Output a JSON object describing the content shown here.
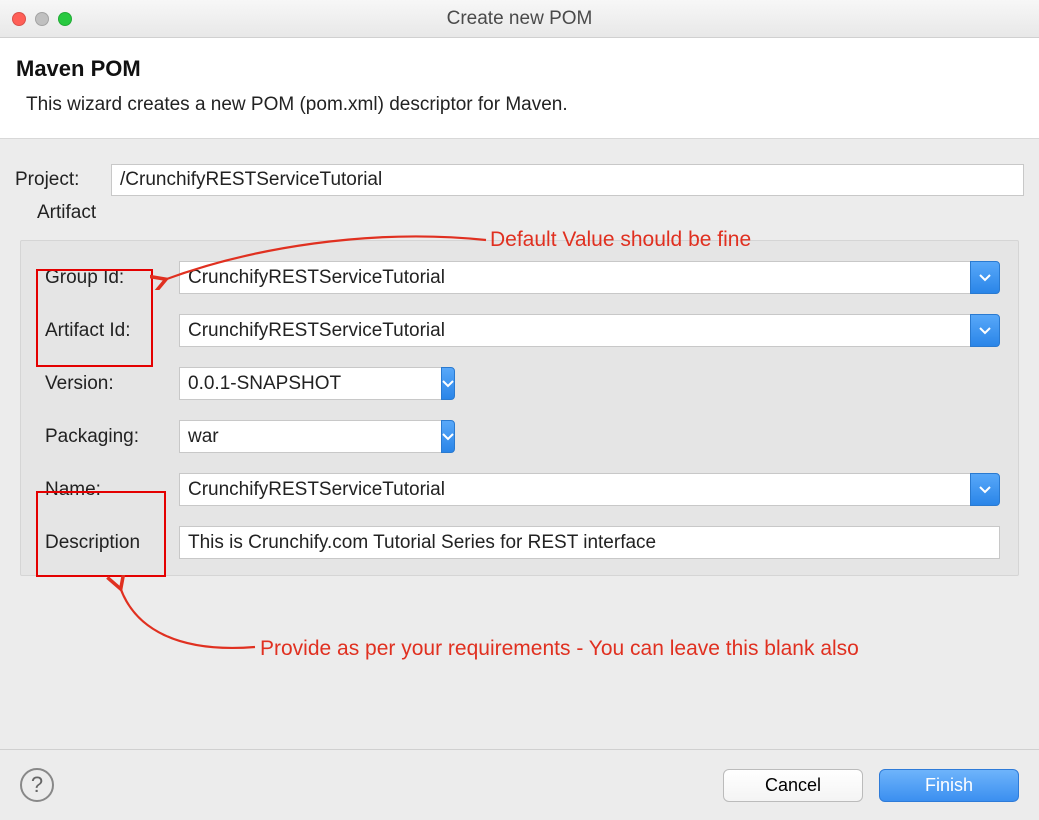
{
  "window": {
    "title": "Create new POM"
  },
  "header": {
    "title": "Maven POM",
    "description": "This wizard creates a new POM (pom.xml) descriptor for Maven."
  },
  "project": {
    "label": "Project:",
    "value": "/CrunchifyRESTServiceTutorial"
  },
  "artifact": {
    "legend": "Artifact",
    "group_id_label": "Group Id:",
    "group_id_value": "CrunchifyRESTServiceTutorial",
    "artifact_id_label": "Artifact Id:",
    "artifact_id_value": "CrunchifyRESTServiceTutorial",
    "version_label": "Version:",
    "version_value": "0.0.1-SNAPSHOT",
    "packaging_label": "Packaging:",
    "packaging_value": "war",
    "name_label": "Name:",
    "name_value": "CrunchifyRESTServiceTutorial",
    "description_label": "Description",
    "description_value": "This is Crunchify.com Tutorial Series for REST interface"
  },
  "annotations": {
    "top": "Default Value should be fine",
    "bottom": "Provide as per your requirements - You can leave this blank also"
  },
  "footer": {
    "cancel": "Cancel",
    "finish": "Finish"
  }
}
